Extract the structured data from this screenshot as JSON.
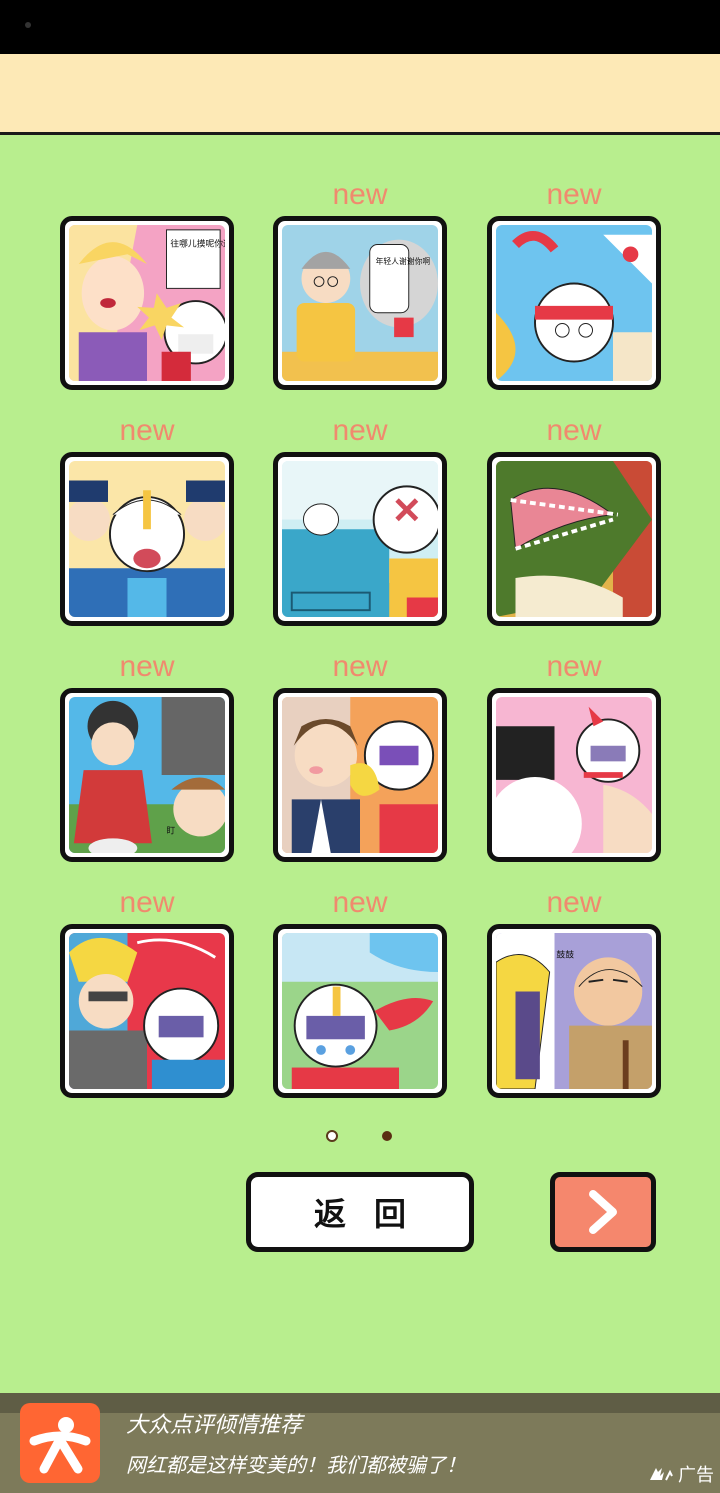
{
  "grid": {
    "new_label": "new",
    "items": [
      {
        "id": 1,
        "new": false,
        "bubble": "往哪儿摸呢你这色狼"
      },
      {
        "id": 2,
        "new": true,
        "bubble": "年轻人谢谢你啊"
      },
      {
        "id": 3,
        "new": true,
        "bubble": ""
      },
      {
        "id": 4,
        "new": true,
        "bubble": ""
      },
      {
        "id": 5,
        "new": true,
        "bubble": ""
      },
      {
        "id": 6,
        "new": true,
        "bubble": ""
      },
      {
        "id": 7,
        "new": true,
        "bubble": "盯"
      },
      {
        "id": 8,
        "new": true,
        "bubble": ""
      },
      {
        "id": 9,
        "new": true,
        "bubble": ""
      },
      {
        "id": 10,
        "new": true,
        "bubble": ""
      },
      {
        "id": 11,
        "new": true,
        "bubble": ""
      },
      {
        "id": 12,
        "new": true,
        "bubble": "鼓鼓"
      }
    ]
  },
  "pager": {
    "current": 2,
    "total": 2
  },
  "buttons": {
    "back_label": "返回",
    "next_icon": "chevron-right-icon"
  },
  "ad": {
    "title": "大众点评倾情推荐",
    "description": "网红都是这样变美的！我们都被骗了！",
    "badge": "广告",
    "logo_icon": "dianping-person-icon"
  },
  "colors": {
    "background": "#b8ee8e",
    "header": "#fde9b6",
    "new_tag": "#f08a6e",
    "next_button": "#f5876d",
    "ad_logo": "#ff6633"
  }
}
